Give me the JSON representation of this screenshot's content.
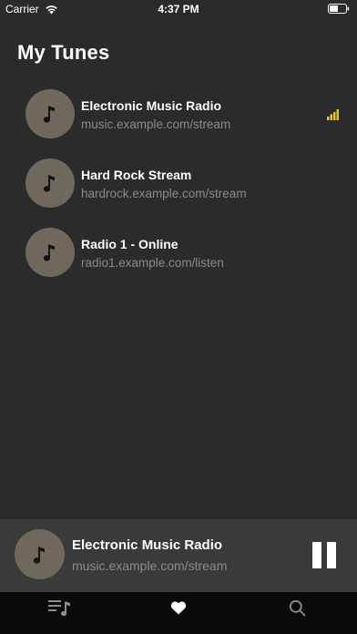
{
  "status_bar": {
    "carrier": "Carrier",
    "time": "4:37 PM"
  },
  "page": {
    "title": "My Tunes"
  },
  "stations": [
    {
      "name": "Electronic Music Radio",
      "url": "music.example.com/stream",
      "playing": true
    },
    {
      "name": "Hard Rock Stream",
      "url": "hardrock.example.com/stream",
      "playing": false
    },
    {
      "name": "Radio 1 - Online",
      "url": "radio1.example.com/listen",
      "playing": false
    }
  ],
  "now_playing": {
    "title": "Electronic Music Radio",
    "url": "music.example.com/stream",
    "state": "playing"
  },
  "tabs": [
    {
      "icon": "playlist-icon",
      "active": false
    },
    {
      "icon": "heart-icon",
      "active": true
    },
    {
      "icon": "search-icon",
      "active": false
    }
  ],
  "colors": {
    "background": "#2b2b2b",
    "artwork": "#6f695d",
    "accent_indicator": "#e8c52a",
    "secondary_text": "#8a8a8a",
    "now_playing_bar": "#3a3a3a",
    "tab_bar": "#0a0a0a",
    "tab_inactive": "#8e8e8e"
  }
}
